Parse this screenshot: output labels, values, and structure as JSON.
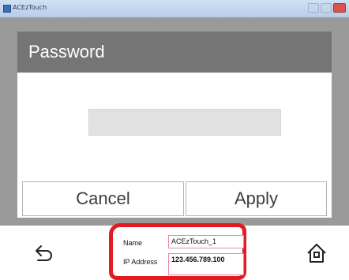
{
  "window": {
    "title": "ACEzTouch",
    "controls": [
      "minimize",
      "maximize",
      "close"
    ]
  },
  "dialog": {
    "title": "Password",
    "password_value": "",
    "cancel_label": "Cancel",
    "apply_label": "Apply"
  },
  "navigation": {
    "back_icon": "back-arrow-icon",
    "home_icon": "home-icon"
  },
  "device_info": {
    "name_label": "Name",
    "name_value": "ACEzTouch_1",
    "ip_label": "IP Address",
    "ip_value": "123.456.789.100"
  },
  "colors": {
    "header": "#757575",
    "frame": "#9a9a9a",
    "highlight": "#e21b23"
  }
}
